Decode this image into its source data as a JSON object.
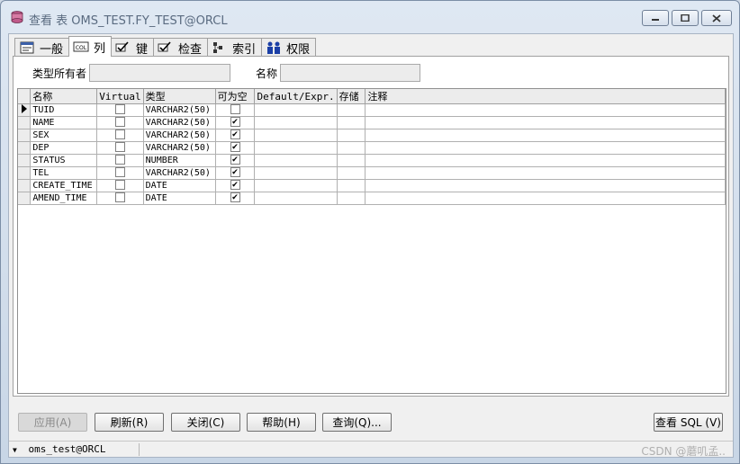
{
  "window": {
    "title": "查看 表 OMS_TEST.FY_TEST@ORCL"
  },
  "tabs": [
    {
      "label": "一般",
      "icon": "general-tab-icon"
    },
    {
      "label": "列",
      "icon": "columns-tab-icon",
      "active": true
    },
    {
      "label": "键",
      "icon": "keys-tab-icon"
    },
    {
      "label": "检查",
      "icon": "check-tab-icon"
    },
    {
      "label": "索引",
      "icon": "index-tab-icon"
    },
    {
      "label": "权限",
      "icon": "privileges-tab-icon"
    }
  ],
  "fields": {
    "type_owner_label": "类型所有者",
    "type_owner_value": "",
    "name_label": "名称",
    "name_value": ""
  },
  "grid": {
    "headers": [
      "名称",
      "Virtual",
      "类型",
      "可为空",
      "Default/Expr.",
      "存储",
      "注释"
    ],
    "rows": [
      {
        "name": "TUID",
        "virtual": false,
        "type": "VARCHAR2(50)",
        "nullable": false,
        "default": "",
        "storage": "",
        "comment": "",
        "current": true
      },
      {
        "name": "NAME",
        "virtual": false,
        "type": "VARCHAR2(50)",
        "nullable": true,
        "default": "",
        "storage": "",
        "comment": ""
      },
      {
        "name": "SEX",
        "virtual": false,
        "type": "VARCHAR2(50)",
        "nullable": true,
        "default": "",
        "storage": "",
        "comment": ""
      },
      {
        "name": "DEP",
        "virtual": false,
        "type": "VARCHAR2(50)",
        "nullable": true,
        "default": "",
        "storage": "",
        "comment": ""
      },
      {
        "name": "STATUS",
        "virtual": false,
        "type": "NUMBER",
        "nullable": true,
        "default": "",
        "storage": "",
        "comment": ""
      },
      {
        "name": "TEL",
        "virtual": false,
        "type": "VARCHAR2(50)",
        "nullable": true,
        "default": "",
        "storage": "",
        "comment": ""
      },
      {
        "name": "CREATE_TIME",
        "virtual": false,
        "type": "DATE",
        "nullable": true,
        "default": "",
        "storage": "",
        "comment": ""
      },
      {
        "name": "AMEND_TIME",
        "virtual": false,
        "type": "DATE",
        "nullable": true,
        "default": "",
        "storage": "",
        "comment": ""
      }
    ]
  },
  "buttons": {
    "apply": "应用(A)",
    "refresh": "刷新(R)",
    "close": "关闭(C)",
    "help": "帮助(H)",
    "query": "查询(Q)...",
    "view_sql": "查看 SQL (V)"
  },
  "status": {
    "connection": "oms_test@ORCL",
    "watermark": "CSDN @蘑叽孟.."
  }
}
